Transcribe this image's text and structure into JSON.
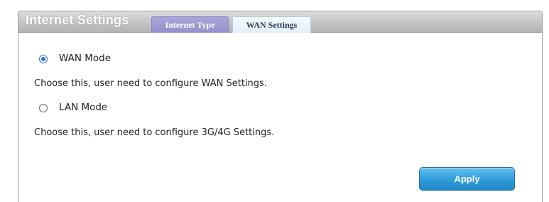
{
  "header": {
    "title": "Internet Settings",
    "tabs": [
      {
        "label": "Internet Type",
        "active": true
      },
      {
        "label": "WAN Settings",
        "active": false
      }
    ]
  },
  "options": [
    {
      "label": "WAN Mode",
      "selected": true,
      "description": "Choose this, user need to configure WAN Settings."
    },
    {
      "label": "LAN Mode",
      "selected": false,
      "description": "Choose this, user need to configure 3G/4G Settings."
    }
  ],
  "actions": {
    "apply_label": "Apply"
  },
  "colors": {
    "active_tab": "#9590cc",
    "inactive_tab": "#e3eff8",
    "apply_button": "#2f9bd9",
    "radio_selected": "#2e6fd0"
  }
}
